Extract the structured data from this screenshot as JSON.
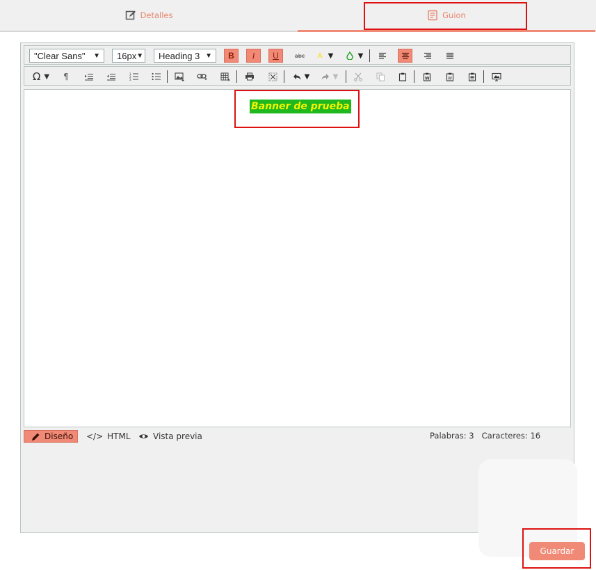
{
  "tabs": {
    "details": "Detalles",
    "script": "Guion"
  },
  "toolbar": {
    "font_family": "\"Clear Sans\"",
    "font_size": "16px",
    "format": "Heading 3",
    "bold": "B",
    "italic": "I",
    "underline": "U",
    "strike": "abc",
    "highlight": "A"
  },
  "icons": [
    "omega-icon",
    "paragraph-icon",
    "indent-icon",
    "outdent-icon",
    "ordered-list-icon",
    "unordered-list-icon",
    "image-icon",
    "link-icon",
    "table-icon",
    "print-icon",
    "fullscreen-icon",
    "undo-icon",
    "redo-icon",
    "cut-icon",
    "copy-icon",
    "paste-icon",
    "paste-word-icon",
    "paste-word-alt-icon",
    "paste-text-icon",
    "preview-icon"
  ],
  "editor": {
    "content": "Banner de prueba"
  },
  "colors": {
    "accent": "#f08a76",
    "banner_bg": "#1fb81f",
    "banner_text": "#f4f400"
  },
  "modes": {
    "design": "Diseño",
    "html": "HTML",
    "preview": "Vista previa"
  },
  "stats": {
    "words": "Palabras: 3",
    "chars": "Caracteres: 16"
  },
  "actions": {
    "save": "Guardar"
  }
}
